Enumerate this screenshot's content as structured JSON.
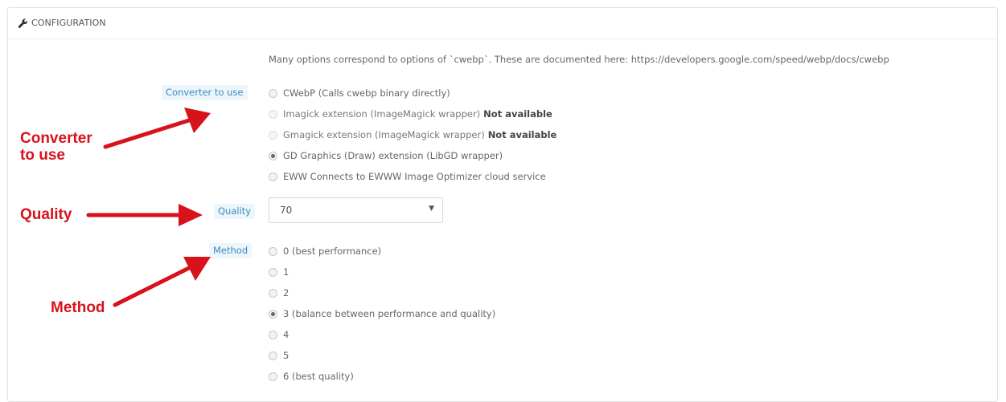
{
  "panel": {
    "header_title": "CONFIGURATION",
    "header_icon": "wrench-icon",
    "intro_text": "Many options correspond to options of `cwebp`. These are documented here: https://developers.google.com/speed/webp/docs/cwebp"
  },
  "converter": {
    "label": "Converter to use",
    "options": [
      {
        "text": "CWebP (Calls cwebp binary directly)",
        "status": "",
        "checked": false,
        "disabled": false
      },
      {
        "text": "Imagick extension (ImageMagick wrapper)",
        "status": "Not available",
        "checked": false,
        "disabled": true
      },
      {
        "text": "Gmagick extension (ImageMagick wrapper)",
        "status": "Not available",
        "checked": false,
        "disabled": true
      },
      {
        "text": "GD Graphics (Draw) extension (LibGD wrapper)",
        "status": "",
        "checked": true,
        "disabled": false
      },
      {
        "text": "EWW Connects to EWWW Image Optimizer cloud service",
        "status": "",
        "checked": false,
        "disabled": false
      }
    ]
  },
  "quality": {
    "label": "Quality",
    "value": "70"
  },
  "method": {
    "label": "Method",
    "options": [
      {
        "text": "0 (best performance)",
        "checked": false
      },
      {
        "text": "1",
        "checked": false
      },
      {
        "text": "2",
        "checked": false
      },
      {
        "text": "3 (balance between performance and quality)",
        "checked": true
      },
      {
        "text": "4",
        "checked": false
      },
      {
        "text": "5",
        "checked": false
      },
      {
        "text": "6 (best quality)",
        "checked": false
      }
    ]
  },
  "annotations": {
    "converter_line1": "Converter",
    "converter_line2": "to use",
    "quality": "Quality",
    "method": "Method",
    "color": "#d8121b"
  },
  "colors": {
    "label_text": "#3a8bbf",
    "label_bg": "#edf6fb"
  }
}
